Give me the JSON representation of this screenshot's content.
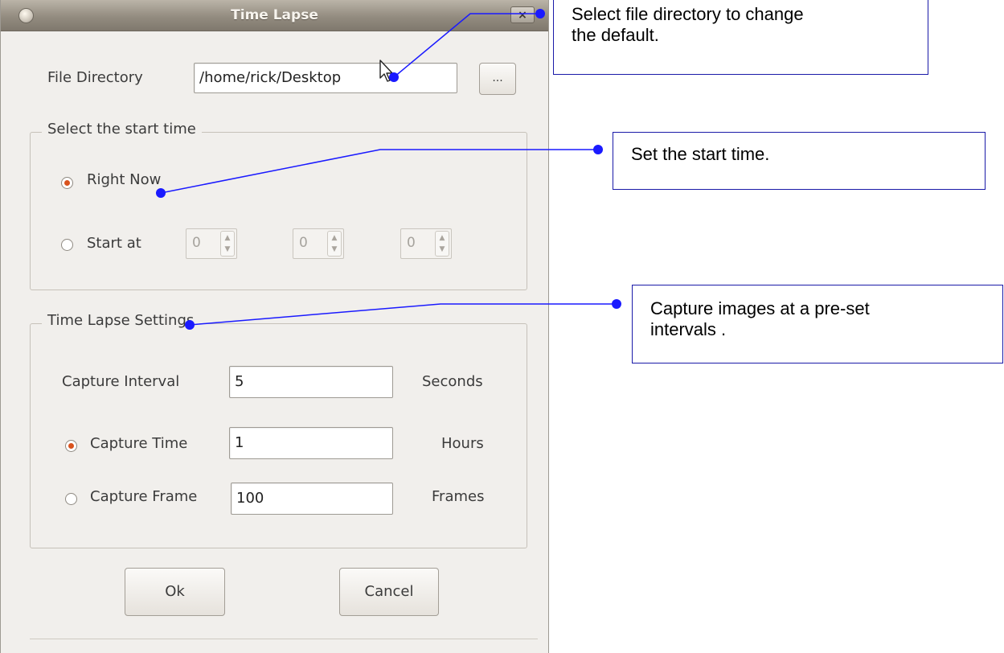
{
  "window": {
    "title": "Time Lapse",
    "close_glyph": "×"
  },
  "file_directory": {
    "label": "File Directory",
    "value": "/home/rick/Desktop",
    "browse_label": "..."
  },
  "start_time": {
    "group_title": "Select the start time",
    "right_now_label": "Right Now",
    "start_at_label": "Start at",
    "spin_values": [
      "0",
      "0",
      "0"
    ],
    "selected": "Right Now"
  },
  "settings": {
    "group_title": "Time Lapse Settings",
    "capture_interval_label": "Capture Interval",
    "capture_interval_value": "5",
    "capture_interval_unit": "Seconds",
    "capture_time_label": "Capture Time",
    "capture_time_value": "1",
    "capture_time_unit": "Hours",
    "capture_frame_label": "Capture Frame",
    "capture_frame_value": "100",
    "capture_frame_unit": "Frames",
    "selected": "Capture Time"
  },
  "buttons": {
    "ok_label": "Ok",
    "cancel_label": "Cancel"
  },
  "callouts": {
    "file_directory": {
      "line1": "Select file directory to change",
      "line2": "the default."
    },
    "start_time": {
      "text": "Set the start time."
    },
    "interval": {
      "line1": "Capture images at a pre-set",
      "line2": "intervals ."
    }
  },
  "colors": {
    "annotation_line": "#1a1aff",
    "radio_selected": "#d9531e",
    "titlebar": "#938c80"
  },
  "icons": {
    "window_menu": "circle-menu-icon",
    "close": "close-icon",
    "cursor": "pointer-arrow-icon",
    "spin": "spin-up-down-icon"
  }
}
